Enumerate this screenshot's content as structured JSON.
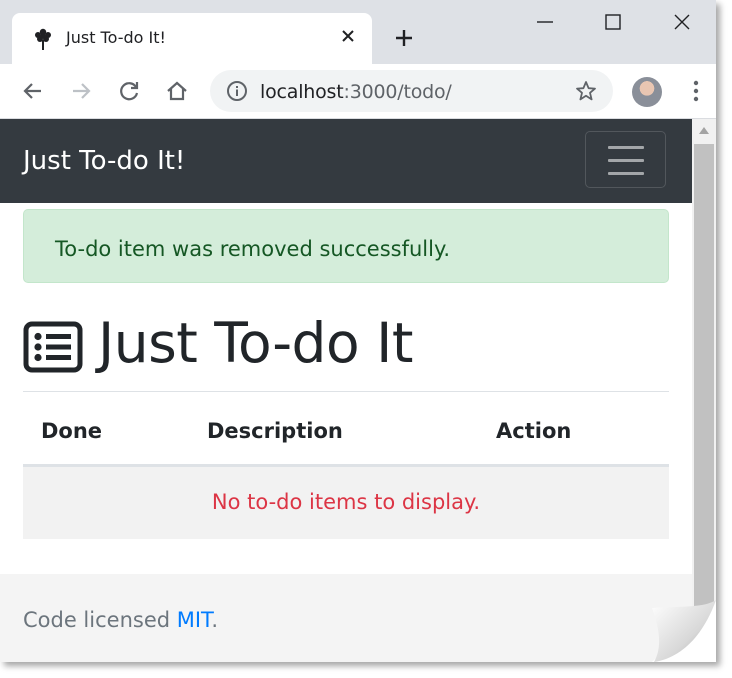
{
  "browser": {
    "tab_title": "Just To-do It!",
    "url_host": "localhost",
    "url_path": ":3000/todo/",
    "icons": [
      "tree-favicon-icon",
      "close-icon",
      "plus-icon",
      "minimize-icon",
      "maximize-icon",
      "window-close-icon",
      "back-arrow-icon",
      "forward-arrow-icon",
      "reload-icon",
      "home-icon",
      "info-icon",
      "star-icon",
      "menu-dots-icon"
    ]
  },
  "navbar": {
    "brand": "Just To-do It!",
    "bg_color": "#343a40"
  },
  "alert": {
    "message": "To-do item was removed successfully.",
    "bg_color": "#d4edda",
    "text_color": "#155724"
  },
  "page": {
    "heading": "Just To-do It",
    "heading_icon": "list-alt-icon"
  },
  "table": {
    "headers": [
      "Done",
      "Description",
      "Action"
    ],
    "empty_message": "No to-do items to display.",
    "empty_color": "#dc3545"
  },
  "footer": {
    "prefix": "Code licensed ",
    "link_text": "MIT",
    "suffix": ".",
    "link_color": "#007bff"
  }
}
